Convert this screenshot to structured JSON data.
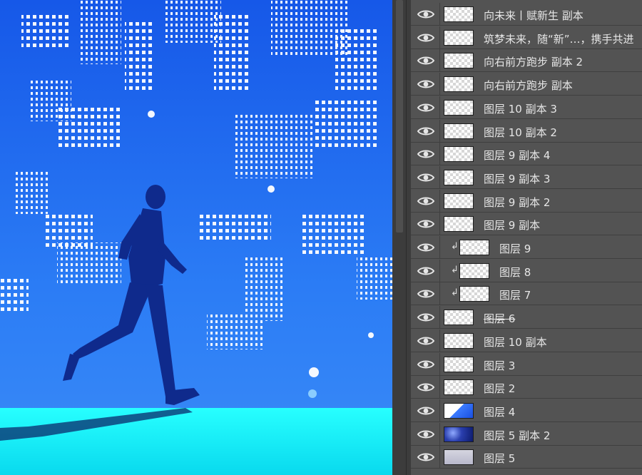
{
  "layers": [
    {
      "name": "向未来丨赋新生 副本",
      "visible": true,
      "clipped": false,
      "thumb": "checker"
    },
    {
      "name": "筑梦未来，随“新”…，携手共进",
      "visible": true,
      "clipped": false,
      "thumb": "checker"
    },
    {
      "name": "向右前方跑步 副本 2",
      "visible": true,
      "clipped": false,
      "thumb": "checker"
    },
    {
      "name": "向右前方跑步 副本",
      "visible": true,
      "clipped": false,
      "thumb": "checker"
    },
    {
      "name": "图层 10 副本 3",
      "visible": true,
      "clipped": false,
      "thumb": "checker"
    },
    {
      "name": "图层 10 副本 2",
      "visible": true,
      "clipped": false,
      "thumb": "checker"
    },
    {
      "name": "图层 9 副本 4",
      "visible": true,
      "clipped": false,
      "thumb": "checker"
    },
    {
      "name": "图层 9 副本 3",
      "visible": true,
      "clipped": false,
      "thumb": "checker"
    },
    {
      "name": "图层 9 副本 2",
      "visible": true,
      "clipped": false,
      "thumb": "checker"
    },
    {
      "name": "图层 9 副本",
      "visible": true,
      "clipped": false,
      "thumb": "checker"
    },
    {
      "name": "图层 9",
      "visible": true,
      "clipped": true,
      "thumb": "checker"
    },
    {
      "name": "图层 8",
      "visible": true,
      "clipped": true,
      "thumb": "checker"
    },
    {
      "name": "图层 7",
      "visible": true,
      "clipped": true,
      "thumb": "checker"
    },
    {
      "name": "图层 6",
      "visible": true,
      "clipped": false,
      "thumb": "checker",
      "strike": true
    },
    {
      "name": "图层 10 副本",
      "visible": true,
      "clipped": false,
      "thumb": "checker"
    },
    {
      "name": "图层 3",
      "visible": true,
      "clipped": false,
      "thumb": "checker"
    },
    {
      "name": "图层 2",
      "visible": true,
      "clipped": false,
      "thumb": "checker"
    },
    {
      "name": "图层 4",
      "visible": true,
      "clipped": false,
      "thumb": "blue"
    },
    {
      "name": "图层 5 副本 2",
      "visible": true,
      "clipped": false,
      "thumb": "city"
    },
    {
      "name": "图层 5",
      "visible": true,
      "clipped": false,
      "thumb": "gray"
    }
  ],
  "clip_glyph": "↲",
  "colors": {
    "sky": "#1f6cf0",
    "floor": "#12f4f6",
    "silhouette": "#0f2a8c",
    "panel": "#535353"
  }
}
